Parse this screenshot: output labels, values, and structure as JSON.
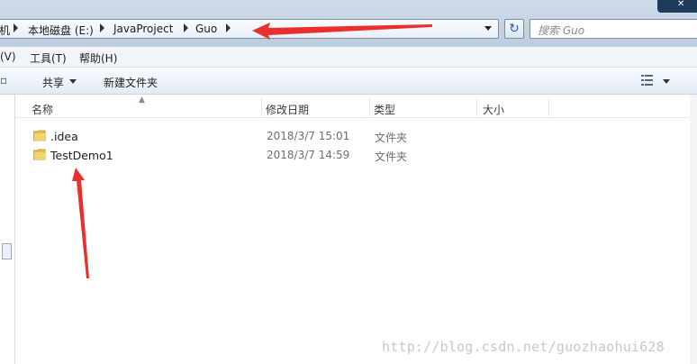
{
  "address": {
    "crumbs": [
      "机",
      "本地磁盘 (E:)",
      "JavaProject",
      "Guo"
    ]
  },
  "search": {
    "placeholder": "搜索 Guo"
  },
  "menu": {
    "items": [
      "(V)",
      "工具(T)",
      "帮助(H)"
    ]
  },
  "toolbar": {
    "share": "共享",
    "new_folder": "新建文件夹"
  },
  "columns": [
    "名称",
    "修改日期",
    "类型",
    "大小"
  ],
  "files": [
    {
      "name": ".idea",
      "date": "2018/3/7 15:01",
      "type": "文件夹"
    },
    {
      "name": "TestDemo1",
      "date": "2018/3/7 14:59",
      "type": "文件夹"
    }
  ],
  "watermark": "http://blog.csdn.net/guozhaohui628",
  "colors": {
    "arrow": "#e8302e",
    "folder": "#e7c24a"
  },
  "icons": [
    "folder-icon",
    "refresh-icon",
    "view-options-icon"
  ]
}
